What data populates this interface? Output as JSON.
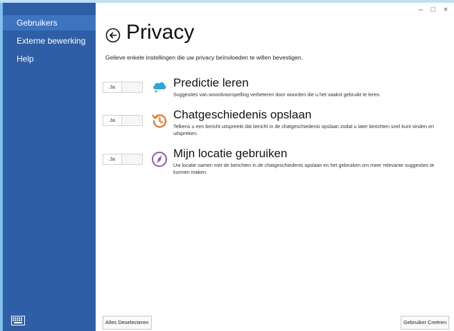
{
  "sidebar": {
    "items": [
      {
        "label": "Gebruikers"
      },
      {
        "label": "Externe bewerking"
      },
      {
        "label": "Help"
      }
    ]
  },
  "window": {
    "minimize": "–",
    "maximize": "□",
    "close": "×"
  },
  "page": {
    "title": "Privacy",
    "subtitle": "Gelieve enkele instellingen die uw privacy beïnvloeden te willen bevestigen."
  },
  "settings": [
    {
      "toggle": "Ja",
      "title": "Predictie leren",
      "description": "Suggesties van woordvoorspelling verbeteren door woorden die u het vaakst gebruikt te leren.",
      "icon": "cloud-icon",
      "color": "#29a8e0"
    },
    {
      "toggle": "Ja",
      "title": "Chatgeschiedenis opslaan",
      "description": "Telkens u een bericht uitspreekt dat bericht in de chatgeschiedenis opslaan zodat u later berichten snel kunt vinden en uitspreken.",
      "icon": "history-icon",
      "color": "#f07a2a"
    },
    {
      "toggle": "Ja",
      "title": "Mijn locatie gebruiken",
      "description": "Uw locatie samen met de berichten in de chatgeschiedenis opslaan en het gebruiken om meer relevante suggesties te kunnen maken.",
      "icon": "compass-icon",
      "color": "#8b5bb0"
    }
  ],
  "footer": {
    "deselect_label": "Alles Deselecteren",
    "create_label": "Gebruiker Creëren"
  },
  "colors": {
    "sidebar": "#2e5fa6",
    "sidebar_active": "#3d74c0"
  }
}
